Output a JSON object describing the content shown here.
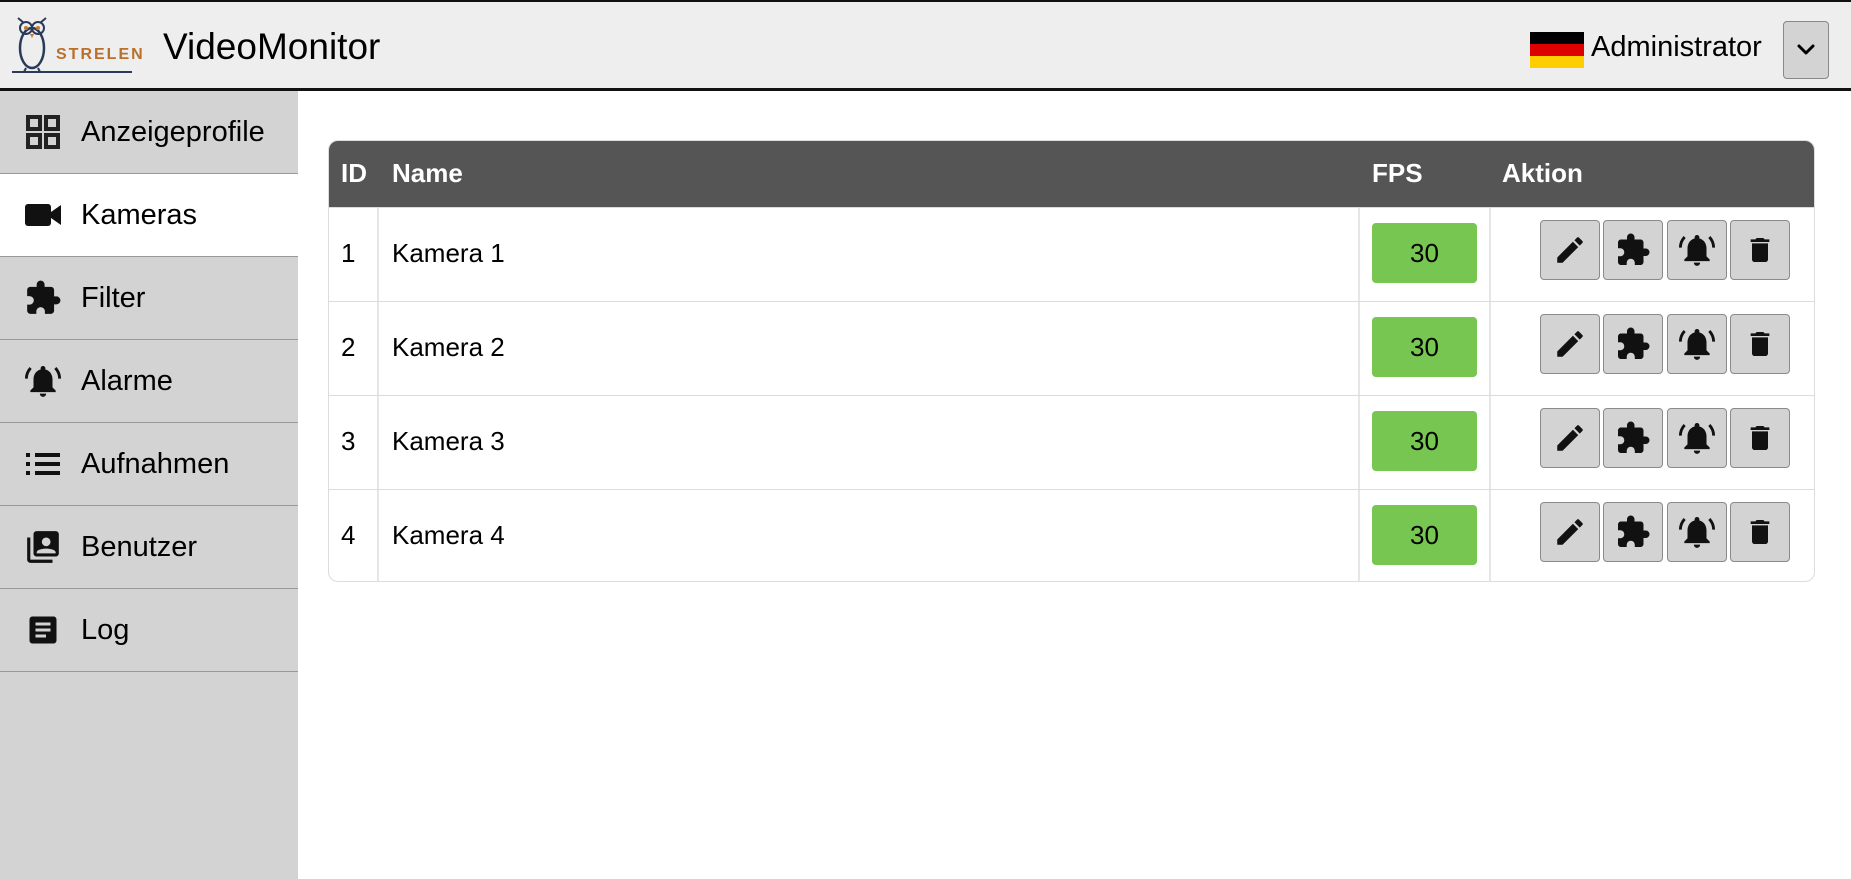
{
  "header": {
    "logo_text": "STRELEN",
    "app_title": "VideoMonitor",
    "user_name": "Administrator",
    "flag_colors": [
      "#000000",
      "#dd0000",
      "#ffce00"
    ]
  },
  "sidebar": {
    "items": [
      {
        "label": "Anzeigeprofile",
        "icon": "grid-icon",
        "active": false
      },
      {
        "label": "Kameras",
        "icon": "videocam-icon",
        "active": true
      },
      {
        "label": "Filter",
        "icon": "puzzle-icon",
        "active": false
      },
      {
        "label": "Alarme",
        "icon": "bell-ring-icon",
        "active": false
      },
      {
        "label": "Aufnahmen",
        "icon": "list-icon",
        "active": false
      },
      {
        "label": "Benutzer",
        "icon": "contacts-icon",
        "active": false
      },
      {
        "label": "Log",
        "icon": "article-icon",
        "active": false
      }
    ]
  },
  "table": {
    "headers": {
      "id": "ID",
      "name": "Name",
      "fps": "FPS",
      "action": "Aktion"
    },
    "rows": [
      {
        "id": "1",
        "name": "Kamera 1",
        "fps": "30"
      },
      {
        "id": "2",
        "name": "Kamera 2",
        "fps": "30"
      },
      {
        "id": "3",
        "name": "Kamera 3",
        "fps": "30"
      },
      {
        "id": "4",
        "name": "Kamera 4",
        "fps": "30"
      }
    ],
    "actions": [
      "edit-icon",
      "puzzle-icon",
      "bell-ring-icon",
      "trash-icon"
    ]
  },
  "colors": {
    "header_bg": "#eeeeee",
    "sidebar_bg": "#d3d3d3",
    "table_header_bg": "#555555",
    "fps_badge": "#76c651"
  }
}
